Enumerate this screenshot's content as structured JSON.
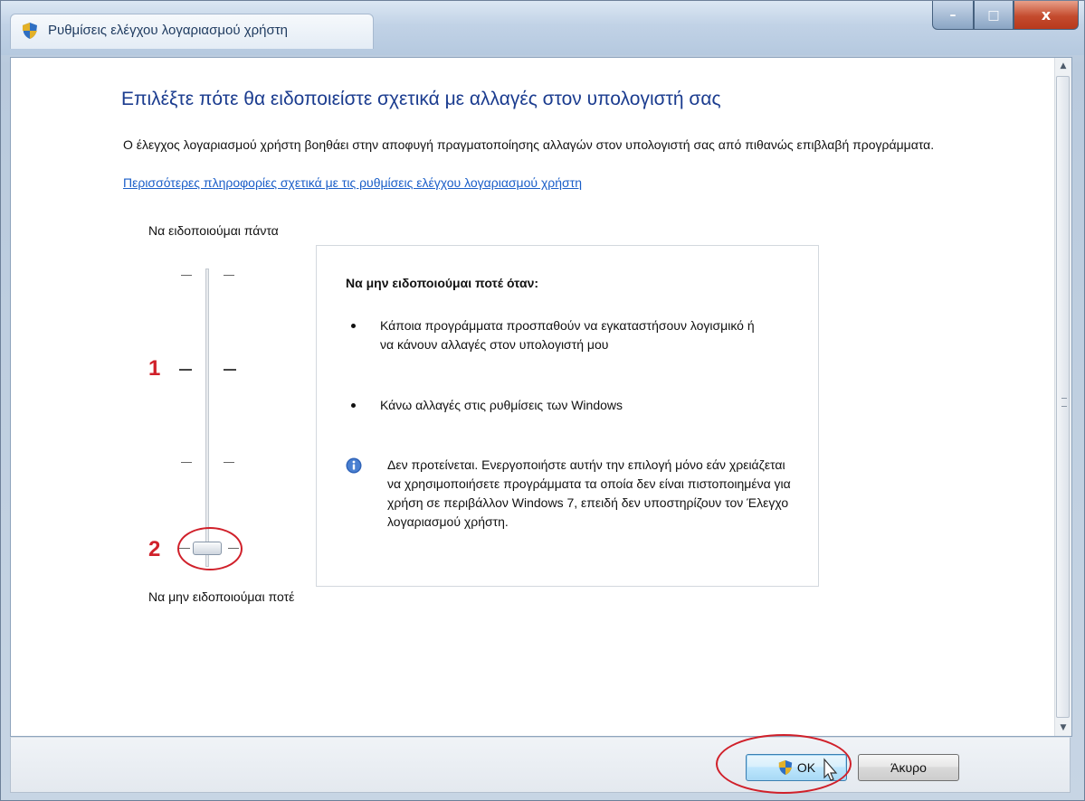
{
  "window": {
    "title": "Ρυθμίσεις ελέγχου λογαριασμού χρήστη"
  },
  "caption_buttons": {
    "minimize": "–",
    "maximize": "□",
    "close": "x"
  },
  "content": {
    "heading": "Επιλέξτε πότε θα ειδοποιείστε σχετικά με αλλαγές στον υπολογιστή σας",
    "description": "Ο έλεγχος λογαριασμού χρήστη βοηθάει στην αποφυγή πραγματοποίησης αλλαγών στον υπολογιστή σας από πιθανώς επιβλαβή προγράμματα.",
    "link": "Περισσότερες πληροφορίες σχετικά με τις ρυθμίσεις ελέγχου λογαριασμού χρήστη"
  },
  "slider": {
    "top_label": "Να ειδοποιούμαι πάντα",
    "bottom_label": "Να μην ειδοποιούμαι ποτέ",
    "levels": 4,
    "selected_level": 1
  },
  "info": {
    "title": "Να μην ειδοποιούμαι ποτέ όταν:",
    "bullets": [
      "Κάποια προγράμματα προσπαθούν να εγκαταστήσουν λογισμικό ή να κάνουν αλλαγές στον υπολογιστή μου",
      "Κάνω αλλαγές στις ρυθμίσεις των Windows"
    ],
    "note": "Δεν προτείνεται. Ενεργοποιήστε αυτήν την επιλογή μόνο εάν χρειάζεται να χρησιμοποιήσετε προγράμματα τα οποία δεν είναι πιστοποιημένα για χρήση σε περιβάλλον Windows 7, επειδή δεν υποστηρίζουν τον Έλεγχο λογαριασμού χρήστη."
  },
  "annotations": {
    "marker_1": "1",
    "marker_2": "2",
    "color": "#d0202a"
  },
  "buttons": {
    "ok": "OK",
    "cancel": "Άκυρο"
  },
  "colors": {
    "heading": "#1b3c8f",
    "link": "#1a5ec8"
  }
}
